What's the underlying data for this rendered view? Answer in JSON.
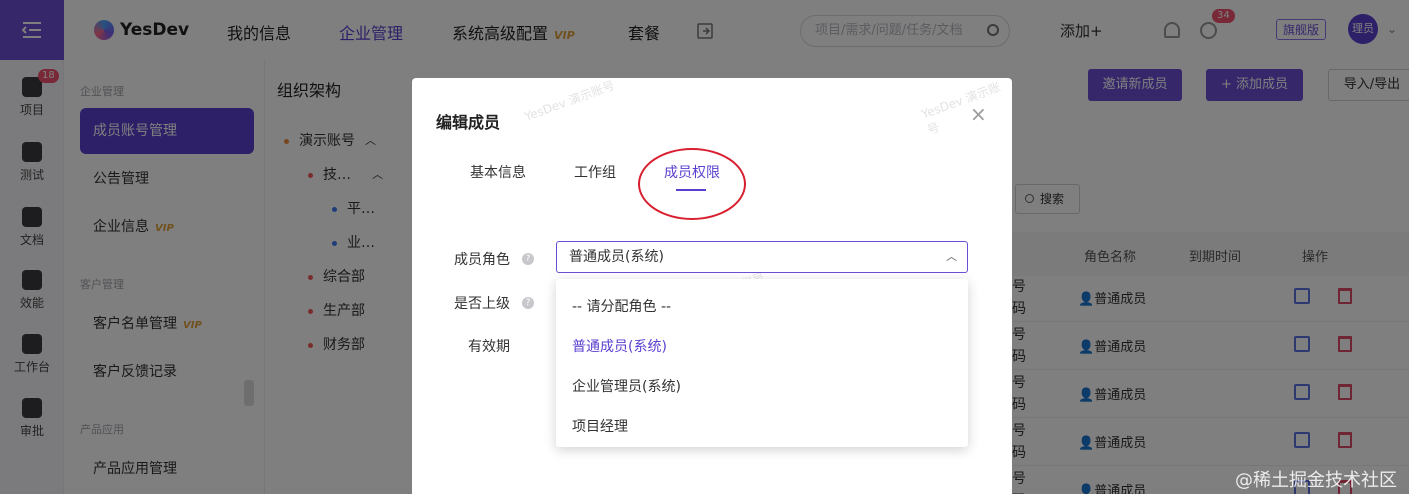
{
  "rail": {
    "items": [
      {
        "label": "项目",
        "badge": "18"
      },
      {
        "label": "测试"
      },
      {
        "label": "文档"
      },
      {
        "label": "效能"
      },
      {
        "label": "工作台"
      },
      {
        "label": "审批"
      }
    ]
  },
  "header": {
    "logo": "YesDev",
    "nav": [
      "我的信息",
      "企业管理",
      "系统高级配置",
      "套餐"
    ],
    "nav_vip": "VIP",
    "search_placeholder": "项目/需求/问题/任务/文档",
    "add_label": "添加+",
    "notification_badge": "34",
    "edition": "旗舰版",
    "avatar": "理员"
  },
  "sidebar": {
    "sections": [
      "企业管理",
      "客户管理",
      "产品应用"
    ],
    "items": [
      {
        "label": "成员账号管理",
        "active": true
      },
      {
        "label": "公告管理"
      },
      {
        "label": "企业信息",
        "vip": "VIP"
      },
      {
        "label": "客户名单管理",
        "vip": "VIP"
      },
      {
        "label": "客户反馈记录"
      },
      {
        "label": "产品应用管理"
      }
    ]
  },
  "org_tree": {
    "title": "组织架构",
    "nodes": [
      "演示账号",
      "技…",
      "平…",
      "业…",
      "综合部",
      "生产部",
      "财务部"
    ]
  },
  "main": {
    "invite_button": "邀请新成员",
    "add_member_button": "+ 添加成员",
    "import_export_button": "导入/导出",
    "search_button": "搜索",
    "columns": [
      "角色名称",
      "到期时间",
      "操作"
    ],
    "rows": [
      {
        "code": "号\n码",
        "role": "普通成员"
      },
      {
        "code": "号\n码",
        "role": "普通成员"
      },
      {
        "code": "号\n码",
        "role": "普通成员"
      },
      {
        "code": "号\n码",
        "role": "普通成员"
      },
      {
        "code": "号\n码",
        "role": "普通成员"
      }
    ]
  },
  "modal": {
    "title": "编辑成员",
    "close": "×",
    "tabs": [
      "基本信息",
      "工作组",
      "成员权限"
    ],
    "active_tab": 2,
    "fields": {
      "role_label": "成员角色",
      "superior_label": "是否上级",
      "validity_label": "有效期"
    },
    "role_value": "普通成员(系统)",
    "role_options": [
      "-- 请分配角色 --",
      "普通成员(系统)",
      "企业管理员(系统)",
      "项目经理"
    ],
    "watermark": "YesDev 演示账号"
  },
  "credit": "@稀土掘金技术社区",
  "colors": {
    "accent": "#5b3fd0",
    "annotation": "#d8202f",
    "vip": "#e2a23b"
  }
}
